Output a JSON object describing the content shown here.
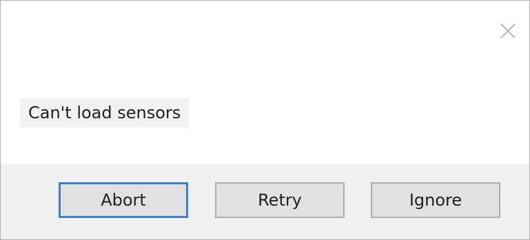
{
  "dialog": {
    "message": "Can't load sensors",
    "close_icon": "close-icon"
  },
  "buttons": {
    "abort_label": "Abort",
    "retry_label": "Retry",
    "ignore_label": "Ignore"
  },
  "colors": {
    "default_button_border": "#3c7fc4",
    "footer_background": "#f0f0f0",
    "button_background": "#e1e1e1"
  }
}
